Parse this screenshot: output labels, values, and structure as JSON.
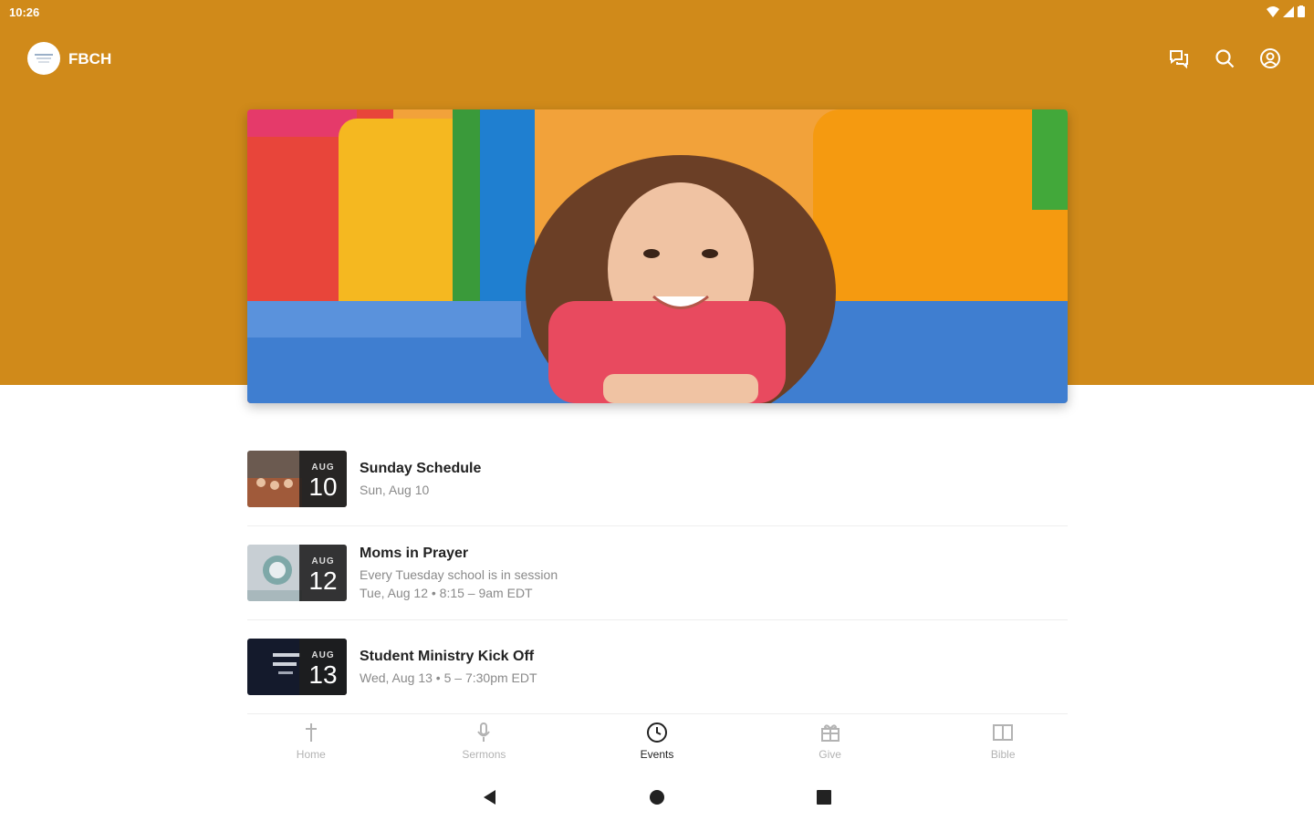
{
  "status": {
    "time": "10:26"
  },
  "header": {
    "title": "FBCH"
  },
  "events": [
    {
      "month": "AUG",
      "day": "10",
      "title": "Sunday Schedule",
      "lines": [
        "Sun, Aug 10"
      ]
    },
    {
      "month": "AUG",
      "day": "12",
      "title": "Moms in Prayer",
      "lines": [
        "Every Tuesday school is in session",
        "Tue, Aug 12 • 8:15 – 9am EDT"
      ]
    },
    {
      "month": "AUG",
      "day": "13",
      "title": "Student Ministry Kick Off",
      "lines": [
        "Wed, Aug 13 • 5 – 7:30pm EDT"
      ]
    }
  ],
  "nav": [
    {
      "label": "Home",
      "icon": "cross-icon"
    },
    {
      "label": "Sermons",
      "icon": "microphone-icon"
    },
    {
      "label": "Events",
      "icon": "clock-icon",
      "active": true
    },
    {
      "label": "Give",
      "icon": "gift-icon"
    },
    {
      "label": "Bible",
      "icon": "book-icon"
    }
  ],
  "colors": {
    "brand": "#d08a1a",
    "active_text": "#222222",
    "inactive_text": "#b3b3b3"
  }
}
